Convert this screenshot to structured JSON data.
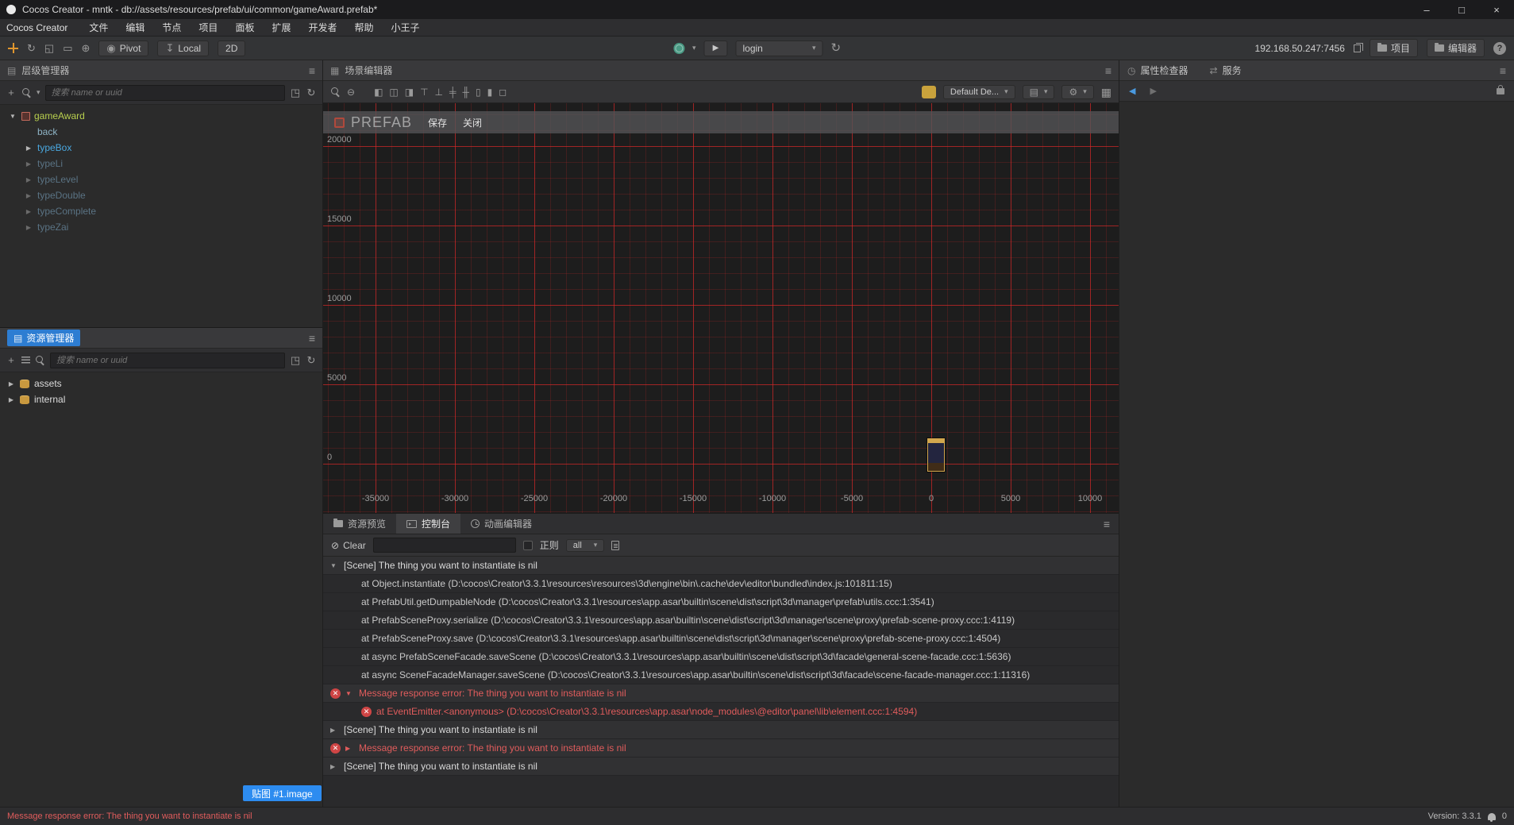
{
  "colors": {
    "accent": "#2d8cf0",
    "panel-active": "#2d7dd2",
    "error": "#e05c5c",
    "grid-line": "#e22828",
    "node-root": "#b8cf4e",
    "node-selected": "#4aa8e0"
  },
  "titlebar": {
    "title": "Cocos Creator - mntk - db://assets/resources/prefab/ui/common/gameAward.prefab*",
    "minimize": "–",
    "maximize": "□",
    "close": "×"
  },
  "menubar": {
    "app_name": "Cocos Creator",
    "items": [
      "文件",
      "编辑",
      "节点",
      "项目",
      "面板",
      "扩展",
      "开发者",
      "帮助",
      "小王子"
    ]
  },
  "toolbar": {
    "pivot_label": "Pivot",
    "local_label": "Local",
    "mode_2d_label": "2D",
    "preview_target": "login",
    "ip_address": "192.168.50.247:7456",
    "project_label": "项目",
    "editor_label": "编辑器",
    "help_label": "?"
  },
  "icons": {
    "hamburger": "≡",
    "refresh": "↻",
    "caret_down": "▾",
    "gear": "⚙",
    "play": "▶",
    "plus": "+",
    "expand": "◳",
    "rotate_tool": "↻",
    "scale_tool": "◱",
    "rect_tool": "▭",
    "anchor_tool": "⊕",
    "pivot_icon": "◉",
    "local_icon": "↧",
    "zoom_out": "⊖",
    "grid": "▦",
    "layers": "▤",
    "clear": "⊘",
    "inspector_icon": "◷",
    "services_icon": "⇄",
    "scene_icon": "▦",
    "hierarchy_icon": "▤",
    "assets_icon": "▤",
    "back_arrow": "◀",
    "fwd_arrow": "▶",
    "align_glyphs": [
      "◧",
      "◫",
      "◨",
      "⊤",
      "⊥",
      "╪",
      "╫",
      "▯",
      "▮",
      "◻"
    ]
  },
  "hierarchy": {
    "title": "层级管理器",
    "search_placeholder": "搜索 name or uuid",
    "nodes": [
      {
        "label": "gameAward",
        "level": 0,
        "caret": "▼",
        "kind": "root"
      },
      {
        "label": "back",
        "level": 1,
        "caret": "",
        "kind": "plain"
      },
      {
        "label": "typeBox",
        "level": 1,
        "caret": "▶",
        "kind": "selected"
      },
      {
        "label": "typeLi",
        "level": 1,
        "caret": "▶",
        "kind": "dim"
      },
      {
        "label": "typeLevel",
        "level": 1,
        "caret": "▶",
        "kind": "dim"
      },
      {
        "label": "typeDouble",
        "level": 1,
        "caret": "▶",
        "kind": "dim"
      },
      {
        "label": "typeComplete",
        "level": 1,
        "caret": "▶",
        "kind": "dim"
      },
      {
        "label": "typeZai",
        "level": 1,
        "caret": "▶",
        "kind": "dim"
      }
    ]
  },
  "assets": {
    "title": "资源管理器",
    "search_placeholder": "搜索 name or uuid",
    "items": [
      {
        "label": "assets"
      },
      {
        "label": "internal"
      }
    ]
  },
  "scene": {
    "title": "场景编辑器",
    "prefab_label": "PREFAB",
    "save_label": "保存",
    "close_label": "关闭",
    "gizmo_preset": "Default De...",
    "y_ticks": [
      "20000",
      "15000",
      "10000",
      "5000",
      "0"
    ],
    "x_ticks": [
      "-35000",
      "-30000",
      "-25000",
      "-20000",
      "-15000",
      "-10000",
      "-5000",
      "0",
      "5000",
      "10000"
    ]
  },
  "console": {
    "tabs": [
      {
        "label": "资源预览",
        "icon": "folder",
        "active": false
      },
      {
        "label": "控制台",
        "icon": "term",
        "active": true
      },
      {
        "label": "动画编辑器",
        "icon": "clock",
        "active": false
      }
    ],
    "clear_label": "Clear",
    "regex_label": "正则",
    "level_filter": "all",
    "logs": [
      {
        "type": "group",
        "caret": "▼",
        "text": "[Scene] The thing you want to instantiate is nil"
      },
      {
        "type": "stack",
        "text": "at Object.instantiate (D:\\cocos\\Creator\\3.3.1\\resources\\resources\\3d\\engine\\bin\\.cache\\dev\\editor\\bundled\\index.js:101811:15)"
      },
      {
        "type": "stack",
        "text": "at PrefabUtil.getDumpableNode (D:\\cocos\\Creator\\3.3.1\\resources\\app.asar\\builtin\\scene\\dist\\script\\3d\\manager\\prefab\\utils.ccc:1:3541)"
      },
      {
        "type": "stack",
        "text": "at PrefabSceneProxy.serialize (D:\\cocos\\Creator\\3.3.1\\resources\\app.asar\\builtin\\scene\\dist\\script\\3d\\manager\\scene\\proxy\\prefab-scene-proxy.ccc:1:4119)"
      },
      {
        "type": "stack",
        "text": "at PrefabSceneProxy.save (D:\\cocos\\Creator\\3.3.1\\resources\\app.asar\\builtin\\scene\\dist\\script\\3d\\manager\\scene\\proxy\\prefab-scene-proxy.ccc:1:4504)"
      },
      {
        "type": "stack",
        "text": "at async PrefabSceneFacade.saveScene (D:\\cocos\\Creator\\3.3.1\\resources\\app.asar\\builtin\\scene\\dist\\script\\3d\\facade\\general-scene-facade.ccc:1:5636)"
      },
      {
        "type": "stack",
        "text": "at async SceneFacadeManager.saveScene (D:\\cocos\\Creator\\3.3.1\\resources\\app.asar\\builtin\\scene\\dist\\script\\3d\\facade\\scene-facade-manager.ccc:1:11316)"
      },
      {
        "type": "error",
        "caret": "▼",
        "text": "Message response error: The thing you want to instantiate is nil"
      },
      {
        "type": "error-stack",
        "text": "at EventEmitter.<anonymous> (D:\\cocos\\Creator\\3.3.1\\resources\\app.asar\\node_modules\\@editor\\panel\\lib\\element.ccc:1:4594)"
      },
      {
        "type": "group",
        "caret": "▶",
        "text": "[Scene] The thing you want to instantiate is nil"
      },
      {
        "type": "error",
        "caret": "▶",
        "text": "Message response error: The thing you want to instantiate is nil"
      },
      {
        "type": "group",
        "caret": "▶",
        "text": "[Scene] The thing you want to instantiate is nil"
      }
    ]
  },
  "inspector": {
    "tab_inspector": "属性检查器",
    "tab_services": "服务"
  },
  "statusbar": {
    "error": "Message response error: The thing you want to instantiate is nil",
    "badge": "贴图 #1.image",
    "version": "Version: 3.3.1",
    "notifications": "0"
  }
}
